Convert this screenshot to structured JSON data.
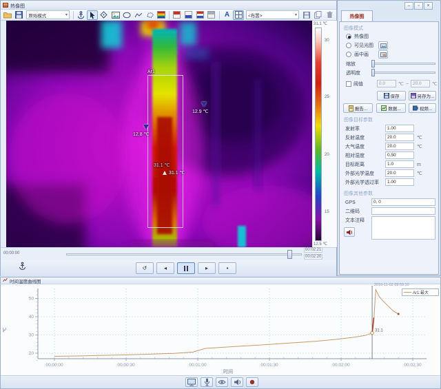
{
  "window_title": "热像图",
  "toolbar": {
    "mode_select": "原始模式",
    "layout_select": "<布置>"
  },
  "thermal": {
    "area_label": "Ar1",
    "spot_left": "12.8 ℃",
    "spot_right": "12.9 ℃",
    "area_max": "31.1 ℃",
    "area_max2": "31.1 ℃"
  },
  "colorbar": {
    "max_label": "31.1 ℃",
    "min_label": "12.5 ℃",
    "ticks": [
      "30",
      "25",
      "20",
      "15"
    ]
  },
  "timeline": {
    "start": "00:00:00",
    "end_line1": "00:02:21",
    "end_line2": "00:02:20"
  },
  "right_panel": {
    "tab": "热像图",
    "image_mode": {
      "header": "图像模式",
      "radio_thermal": "热像图",
      "radio_visible": "可见光图",
      "radio_pip": "画中画",
      "zoom_label": "缩放",
      "opacity_label": "透明度",
      "threshold_label": "阈值",
      "threshold_low": "0.0",
      "threshold_high": "20.0",
      "unit_c": "℃",
      "range_sep": "~",
      "save_btn": "保存",
      "saveas_btn": "另存为...",
      "report_btn": "报告...",
      "data_btn": "数据...",
      "video_btn": "视频..."
    },
    "object_params": {
      "header": "图像目标参数",
      "rows": [
        {
          "label": "发射率",
          "value": "1.00",
          "unit": ""
        },
        {
          "label": "反射温度",
          "value": "20.0",
          "unit": "℃"
        },
        {
          "label": "大气温度",
          "value": "20.0",
          "unit": "℃"
        },
        {
          "label": "相对湿度",
          "value": "0.50",
          "unit": ""
        },
        {
          "label": "目标距离",
          "value": "1.0",
          "unit": "m"
        },
        {
          "label": "外部光学温度",
          "value": "20.0",
          "unit": "℃"
        },
        {
          "label": "外部光学透过率",
          "value": "1.00",
          "unit": ""
        }
      ]
    },
    "other_params": {
      "header": "图像其他参数",
      "gps_label": "GPS",
      "gps_value": "0, 0",
      "qr_label": "二维码",
      "qr_value": "",
      "note_label": "文本注释",
      "note_value": ""
    }
  },
  "chart_window": {
    "title": "时间温度曲线图"
  },
  "chart_data": {
    "type": "line",
    "title": "",
    "xlabel": "时间",
    "ylabel": "℃",
    "grid": true,
    "ylim": [
      14,
      56
    ],
    "yticks": [
      20,
      30,
      40,
      50
    ],
    "xticks": [
      {
        "t": 0,
        "label": "00:00:00"
      },
      {
        "t": 30,
        "label": "00:00:30"
      },
      {
        "t": 60,
        "label": "00:01:00"
      },
      {
        "t": 90,
        "label": "00:01:30"
      },
      {
        "t": 120,
        "label": "00:02:00"
      },
      {
        "t": 150,
        "label": "00:02:30"
      }
    ],
    "legend": {
      "position": "top-right",
      "label": "Ar1:最大",
      "color": "#c89a66"
    },
    "series": [
      {
        "name": "Ar1:最大",
        "color": "#c89a66",
        "points": [
          [
            0,
            18.3
          ],
          [
            10,
            18.5
          ],
          [
            20,
            18.8
          ],
          [
            30,
            19.1
          ],
          [
            40,
            19.5
          ],
          [
            50,
            19.9
          ],
          [
            58,
            20.6
          ],
          [
            63,
            22.6
          ],
          [
            70,
            23.2
          ],
          [
            80,
            24.0
          ],
          [
            90,
            24.8
          ],
          [
            100,
            25.7
          ],
          [
            110,
            26.6
          ],
          [
            118,
            27.6
          ],
          [
            125,
            28.7
          ],
          [
            130,
            29.7
          ],
          [
            133,
            31.1
          ],
          [
            133.8,
            40.0
          ],
          [
            134.5,
            54.8
          ],
          [
            136,
            51.0
          ],
          [
            138,
            48.0
          ],
          [
            140,
            45.5
          ],
          [
            142,
            43.0
          ],
          [
            144,
            41.5
          ]
        ]
      }
    ],
    "highlight_segment": {
      "color": "#cc3311",
      "points": [
        [
          133.1,
          31.8
        ],
        [
          133.7,
          39.5
        ]
      ]
    },
    "cursor": {
      "t": 133,
      "date_label": "2016-11-02 09:59:10",
      "value": 31.1,
      "value_label": "31.1"
    }
  }
}
